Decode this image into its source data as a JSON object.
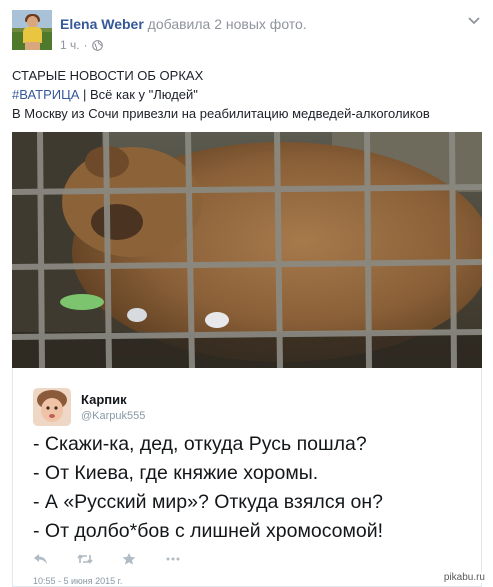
{
  "post": {
    "author": "Elena Weber",
    "action": "добавила 2 новых фото.",
    "time": "1 ч.",
    "separator": "·",
    "privacy_icon": "globe-icon",
    "menu_icon": "chevron-down-icon"
  },
  "text": {
    "line1": "СТАРЫЕ НОВОСТИ ОБ ОРКАХ",
    "hashtag": "#ВАТРИЦА",
    "line2_rest": " | Всё как у \"Людей\"",
    "line3": "В Москву из Сочи привезли на реабилитацию медведей-алкоголиков"
  },
  "photo": {
    "subject": "bear behind cage bars"
  },
  "tweet": {
    "name": "Карпик",
    "handle": "@Karpuk555",
    "lines": [
      "- Скажи-ка, дед, откуда Русь пошла?",
      "- От Киева, где княжие хоромы.",
      "- А «Русский мир»? Откуда взялся он?",
      "- От долбо*бов с лишней хромосомой!"
    ],
    "actions": [
      "reply-icon",
      "retweet-icon",
      "like-icon",
      "more-icon"
    ],
    "date": "10:55 - 5 июня 2015 г."
  },
  "watermark": "pikabu.ru",
  "colors": {
    "link": "#365899",
    "meta": "#90949c",
    "text": "#1d2129",
    "tweet_border": "#e1e8ed"
  }
}
